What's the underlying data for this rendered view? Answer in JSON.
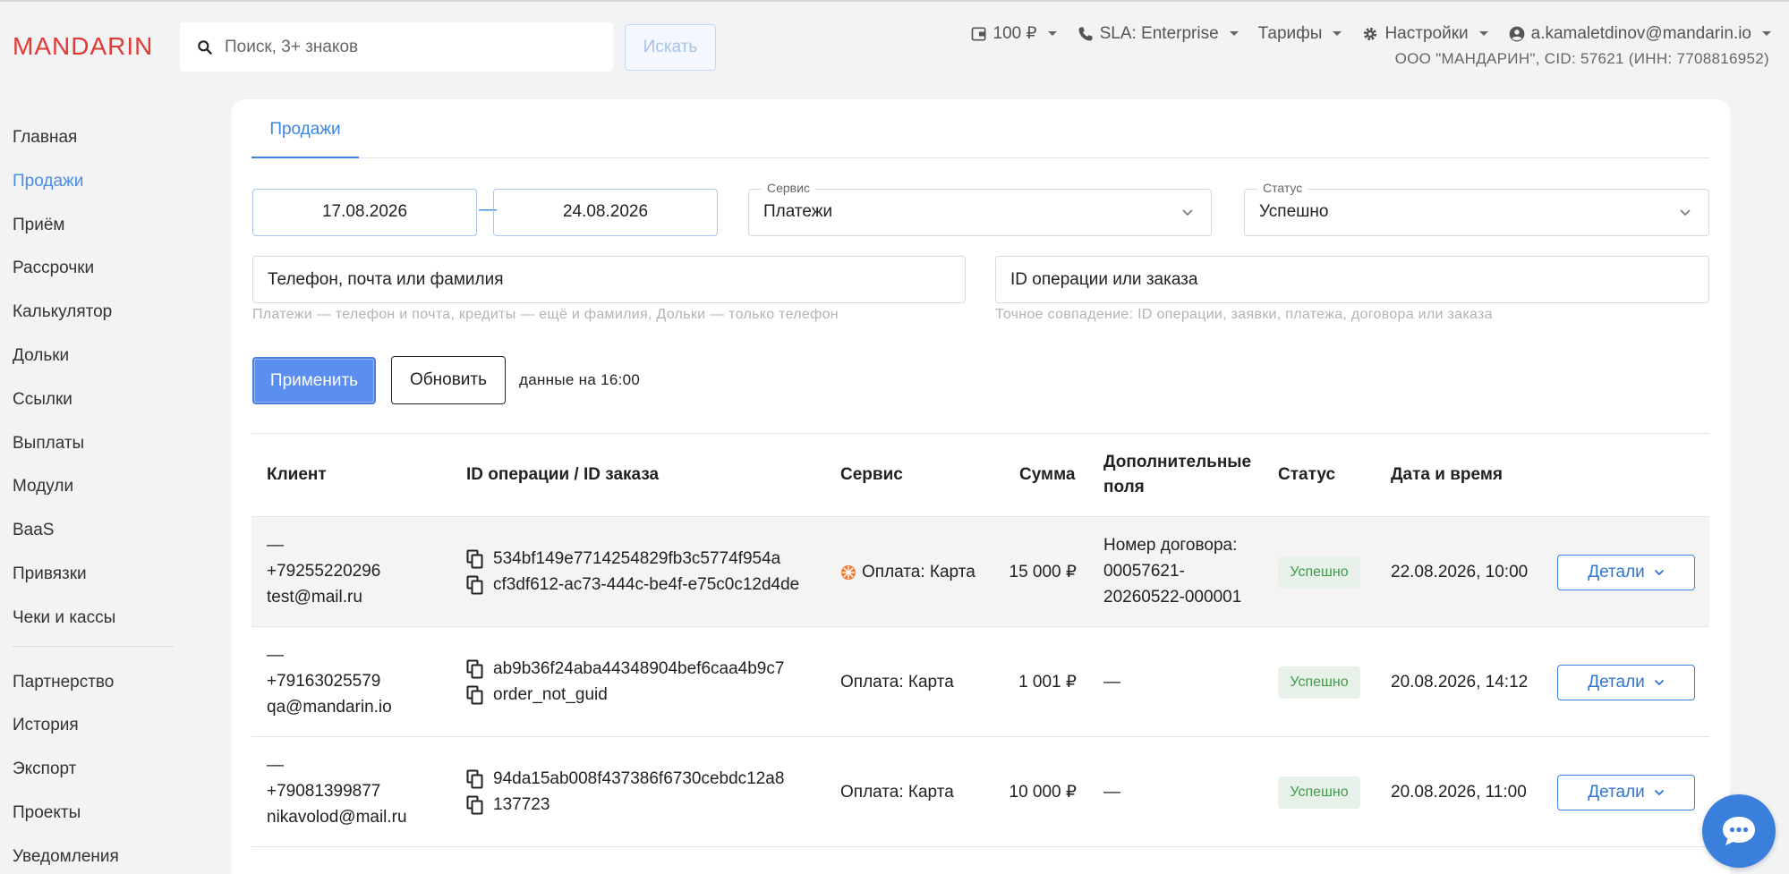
{
  "header": {
    "logo": "MANDARIN",
    "search_placeholder": "Поиск, 3+ знаков",
    "search_button": "Искать",
    "balance": "100 ₽",
    "sla": "SLA: Enterprise",
    "tariffs": "Тарифы",
    "settings": "Настройки",
    "user": "a.kamaletdinov@mandarin.io",
    "org": "ООО \"МАНДАРИН\", CID: 57621 (ИНН: 7708816952)"
  },
  "sidebar": {
    "items": [
      "Главная",
      "Продажи",
      "Приём",
      "Рассрочки",
      "Калькулятор",
      "Дольки",
      "Ссылки",
      "Выплаты",
      "Модули",
      "BaaS",
      "Привязки",
      "Чеки и кассы"
    ],
    "items2": [
      "Партнерство",
      "История",
      "Экспорт",
      "Проекты",
      "Уведомления"
    ],
    "active": "Продажи"
  },
  "main": {
    "tab": "Продажи",
    "date_from": "17.08.2026",
    "date_to": "24.08.2026",
    "date_separator": "—",
    "service": {
      "legend": "Сервис",
      "value": "Платежи"
    },
    "status": {
      "legend": "Статус",
      "value": "Успешно"
    },
    "client_search": {
      "placeholder": "Телефон, почта или фамилия",
      "hint": "Платежи — телефон и почта, кредиты — ещё и фамилия, Дольки — только телефон"
    },
    "id_search": {
      "placeholder": "ID операции или заказа",
      "hint": "Точное совпадение: ID операции, заявки, платежа, договора или заказа"
    },
    "apply_button": "Применить",
    "refresh_button": "Обновить",
    "data_as_of": "данные на 16:00"
  },
  "table": {
    "headers": {
      "client": "Клиент",
      "ids": "ID операции / ID заказа",
      "service": "Сервис",
      "amount": "Сумма",
      "extra_1": "Дополнительные",
      "extra_2": "поля",
      "status": "Статус",
      "datetime": "Дата и время"
    },
    "rows": [
      {
        "client_name": "—",
        "phone": "+79255220296",
        "email": "test@mail.ru",
        "operation_id": "534bf149e7714254829fb3c5774f954a",
        "order_id": "cf3df612-ac73-444c-be4f-e75c0c12d4de",
        "service": "Оплата: Карта",
        "amount": "15 000 ₽",
        "extra_1": "Номер договора:",
        "extra_2": "00057621-",
        "extra_3": "20260522-000001",
        "status": "Успешно",
        "datetime": "22.08.2026, 10:00",
        "details": "Детали"
      },
      {
        "client_name": "—",
        "phone": "+79163025579",
        "email": "qa@mandarin.io",
        "operation_id": "ab9b36f24aba44348904bef6caa4b9c7",
        "order_id": "order_not_guid",
        "service": "Оплата: Карта",
        "amount": "1 001 ₽",
        "extra_1": "—",
        "status": "Успешно",
        "datetime": "20.08.2026, 14:12",
        "details": "Детали"
      },
      {
        "client_name": "—",
        "phone": "+79081399877",
        "email": "nikavolod@mail.ru",
        "operation_id": "94da15ab008f437386f6730cebdc12a8",
        "order_id": "137723",
        "service": "Оплата: Карта",
        "amount": "10 000 ₽",
        "extra_1": "—",
        "status": "Успешно",
        "datetime": "20.08.2026, 11:00",
        "details": "Детали"
      }
    ]
  },
  "colors": {
    "accent": "#3a86e0",
    "logo": "#e03a34",
    "success_bg": "#e8f1e9",
    "success_text": "#3d9b4a"
  }
}
